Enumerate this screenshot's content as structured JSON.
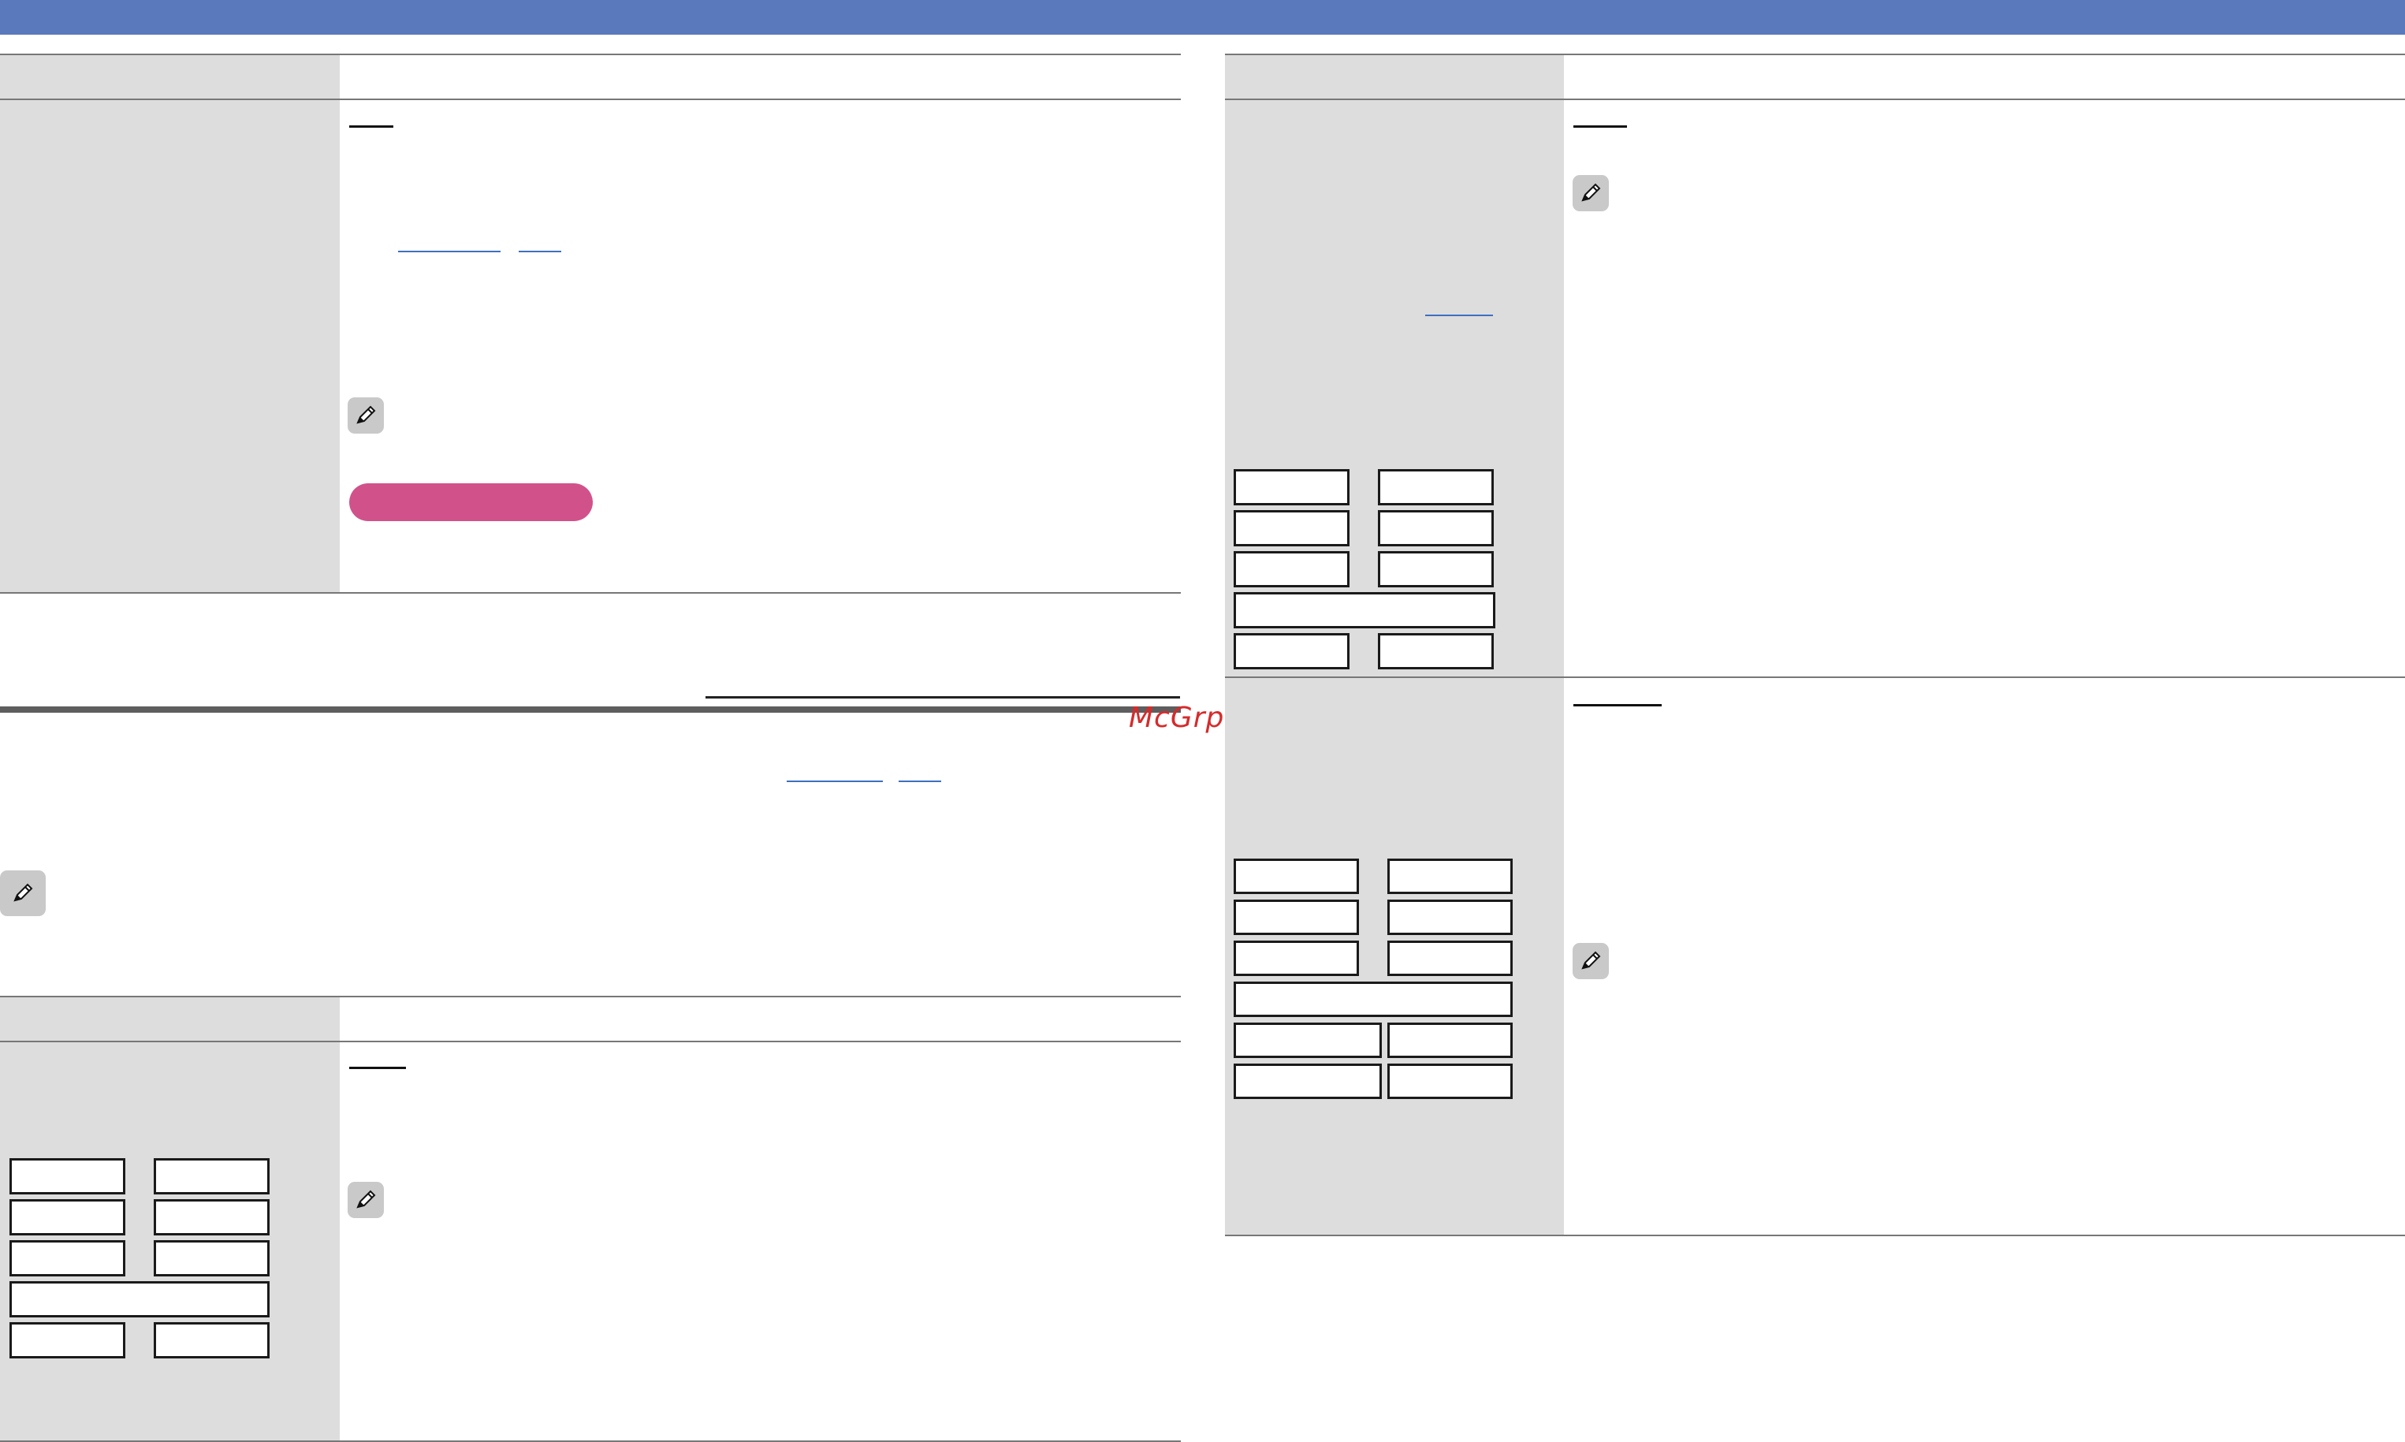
{
  "watermark": {
    "text": "McGrp.Ru"
  },
  "colors": {
    "top_bar": "#5a79bd",
    "table_shade": "#dcdddc",
    "pill": "#d1528b",
    "link": "#3e6fc2",
    "watermark": "#d62b2b"
  },
  "icons": {
    "note": "pencil-note-icon"
  }
}
